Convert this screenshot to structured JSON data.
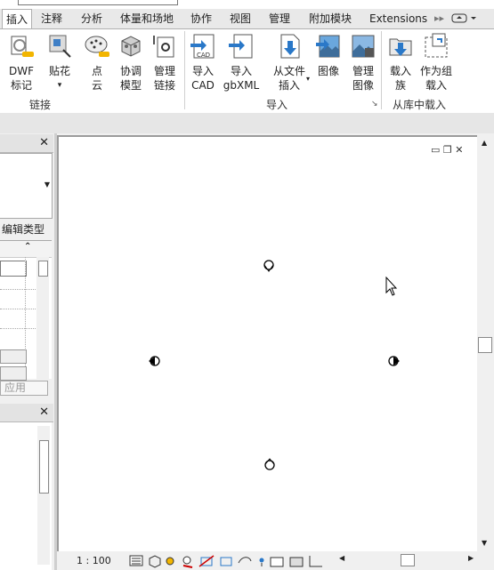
{
  "tabs": [
    {
      "label": "插入",
      "active": true
    },
    {
      "label": "注释"
    },
    {
      "label": "分析"
    },
    {
      "label": "体量和场地"
    },
    {
      "label": "协作"
    },
    {
      "label": "视图"
    },
    {
      "label": "管理"
    },
    {
      "label": "附加模块"
    },
    {
      "label": "Extensions"
    }
  ],
  "ribbon": {
    "groups": [
      {
        "label": "链接"
      },
      {
        "label": "导入"
      },
      {
        "label": "从库中载入"
      }
    ],
    "buttons": [
      {
        "line1": "DWF",
        "line2": "标记",
        "icon": "dwf-markup-icon"
      },
      {
        "line1": "贴花",
        "line2": "▾",
        "icon": "decal-icon"
      },
      {
        "line1": "点",
        "line2": "云",
        "icon": "point-cloud-icon"
      },
      {
        "line1": "协调",
        "line2": "模型",
        "icon": "coordination-model-icon"
      },
      {
        "line1": "管理",
        "line2": "链接",
        "icon": "manage-links-icon"
      },
      {
        "line1": "导入",
        "line2": "CAD",
        "icon": "import-cad-icon"
      },
      {
        "line1": "导入",
        "line2": "gbXML",
        "icon": "import-gbxml-icon"
      },
      {
        "line1": "从文件",
        "line2": "插入",
        "icon": "insert-from-file-icon"
      },
      {
        "line1": "图像",
        "line2": "",
        "icon": "image-icon"
      },
      {
        "line1": "管理",
        "line2": "图像",
        "icon": "manage-images-icon"
      },
      {
        "line1": "载入",
        "line2": "族",
        "icon": "load-family-icon"
      },
      {
        "line1": "作为组",
        "line2": "载入",
        "icon": "load-as-group-icon"
      }
    ]
  },
  "properties": {
    "edit_type_label": "编辑类型",
    "apply_label": "应用"
  },
  "status": {
    "scale": "1 : 100"
  },
  "colors": {
    "import_blue": "#2a78c8",
    "tab_bg": "#e9e9e9",
    "ribbon_bg": "#ffffff"
  }
}
